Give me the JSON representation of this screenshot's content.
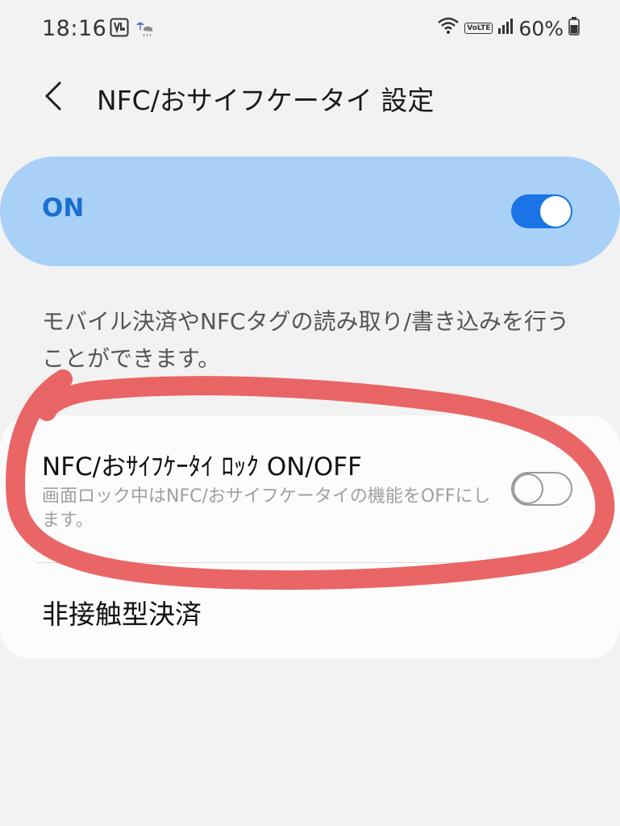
{
  "status_bar": {
    "time": "18:16",
    "battery_percent": "60%",
    "volte_label": "VoLTE",
    "icons": [
      "voicemail-icon",
      "weather-icon",
      "wifi-icon",
      "signal-icon",
      "battery-icon"
    ]
  },
  "header": {
    "title": "NFC/おサイフケータイ 設定",
    "back_icon": "chevron-left-icon"
  },
  "master_switch": {
    "label": "ON",
    "state": true,
    "accent_color": "#1b73e8",
    "background_color": "#a9d0f7"
  },
  "description": "モバイル決済やNFCタグの読み取り/書き込みを行うことができます。",
  "settings": {
    "lock": {
      "title": "NFC/おｻｲﾌｹｰﾀｲ ﾛｯｸ ON/OFF",
      "subtitle": "画面ロック中はNFC/おサイフケータイの機能をOFFにします。",
      "state": false
    },
    "contactless": {
      "title": "非接触型決済"
    }
  },
  "annotation": {
    "color": "#e85a5a"
  }
}
